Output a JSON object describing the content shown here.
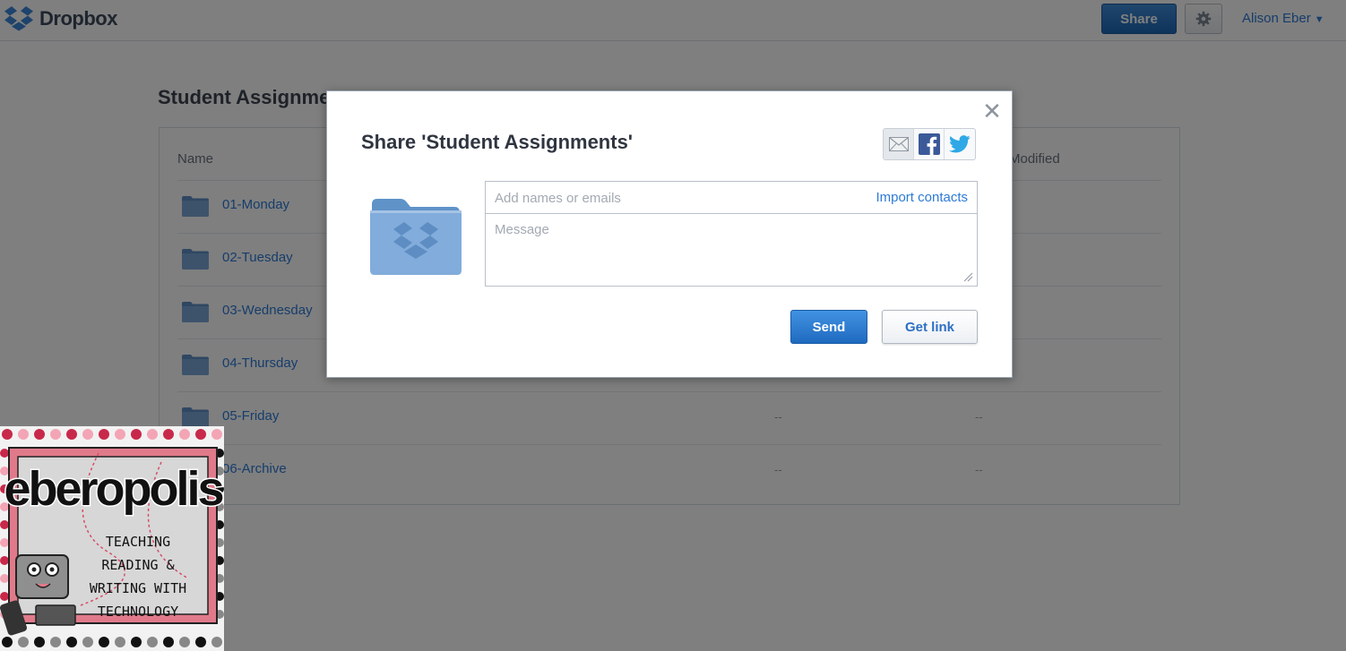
{
  "topbar": {
    "brand": "Dropbox",
    "share_label": "Share",
    "user_name": "Alison Eber",
    "icons": {
      "logo": "dropbox-logo-icon",
      "settings": "gear-icon",
      "menu": "caret-down-icon"
    }
  },
  "page": {
    "title": "Student Assignments",
    "columns": {
      "name": "Name",
      "modified": "Modified"
    },
    "folders": [
      {
        "name": "01-Monday",
        "c1": "",
        "c2": ""
      },
      {
        "name": "02-Tuesday",
        "c1": "",
        "c2": ""
      },
      {
        "name": "03-Wednesday",
        "c1": "",
        "c2": ""
      },
      {
        "name": "04-Thursday",
        "c1": "",
        "c2": ""
      },
      {
        "name": "05-Friday",
        "c1": "--",
        "c2": "--"
      },
      {
        "name": "06-Archive",
        "c1": "--",
        "c2": "--"
      }
    ]
  },
  "modal": {
    "title": "Share 'Student Assignments'",
    "recipients_placeholder": "Add names or emails",
    "import_contacts": "Import contacts",
    "message_placeholder": "Message",
    "send_label": "Send",
    "get_link_label": "Get link",
    "icons": {
      "close": "close-icon",
      "email": "email-icon",
      "facebook": "facebook-icon",
      "twitter": "twitter-icon",
      "folder": "shared-folder-icon"
    }
  },
  "badge": {
    "brand": "eberopolis",
    "tagline_lines": [
      "TEACHING",
      "READING &",
      "WRITING WITH",
      "TECHNOLOGY"
    ]
  },
  "colors": {
    "accent": "#2d7ad6",
    "primary_button": "#1f68b8",
    "text_dark": "#2f3540",
    "badge_pink": "#e07a8a"
  }
}
